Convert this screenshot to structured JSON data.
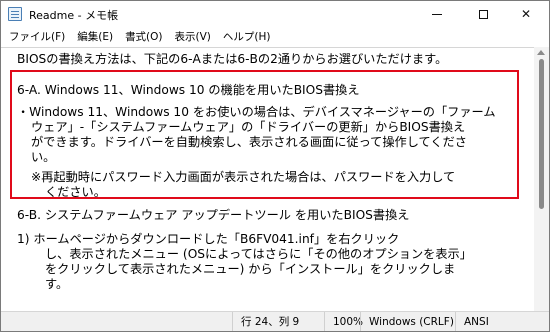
{
  "window": {
    "title": "Readme - メモ帳",
    "icon": "notepad-icon",
    "controls": {
      "minimize": "minimize-icon",
      "maximize": "maximize-icon",
      "close": "✕"
    }
  },
  "menu": [
    "ファイル(F)",
    "編集(E)",
    "書式(O)",
    "表示(V)",
    "ヘルプ(H)"
  ],
  "content": {
    "lines": [
      "BIOSの書換え方法は、下記の6-Aまたは6-Bの2通りからお選びいただけます。",
      "6-A. Windows 11、Windows 10 の機能を用いたBIOS書換え",
      "・Windows 11、Windows 10 をお使いの場合は、デバイスマネージャーの「ファーム",
      "ウェア」-「システムファームウェア」の「ドライバーの更新」からBIOS書換え",
      "ができます。ドライバーを自動検索し、表示される画面に従って操作してくださ",
      "い。",
      "※再起動時にパスワード入力画面が表示された場合は、パスワードを入力して",
      "ください。",
      "6-B. システムファームウェア アップデートツール を用いたBIOS書換え",
      "1) ホームページからダウンロードした「B6FV041.inf」を右クリック",
      "し、表示されたメニュー (OSによってはさらに「その他のオプションを表示」",
      "をクリックして表示されたメニュー) から「インストール」をクリックしま",
      "す。"
    ]
  },
  "statusbar": {
    "position": "行 24、列 9",
    "zoom": "100%",
    "line_ending": "Windows (CRLF)",
    "encoding": "ANSI"
  },
  "colors": {
    "highlight_border": "#e00a1a",
    "statusbar_bg": "#f0f0f0"
  }
}
